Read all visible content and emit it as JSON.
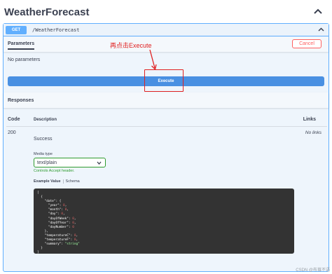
{
  "section_title": "WeatherForecast",
  "operation": {
    "method": "GET",
    "path": "/WeatherForecast"
  },
  "parameters": {
    "tab_label": "Parameters",
    "cancel_label": "Cancel",
    "empty_text": "No parameters"
  },
  "execute": {
    "label": "Execute",
    "annotation": "再点击Execute"
  },
  "responses": {
    "header": "Responses",
    "columns": {
      "code": "Code",
      "description": "Description",
      "links": "Links"
    },
    "row": {
      "code": "200",
      "description": "Success",
      "links": "No links"
    },
    "media_type_label": "Media type",
    "media_type_value": "text/plain",
    "controls_accept": "Controls Accept header.",
    "tabs": {
      "example_value": "Example Value",
      "schema": "Schema"
    },
    "example": [
      "[",
      "  {",
      "    \"date\": {",
      "      \"year\": 0,",
      "      \"month\": 0,",
      "      \"day\": 0,",
      "      \"dayOfWeek\": 0,",
      "      \"dayOfYear\": 0,",
      "      \"dayNumber\": 0",
      "    },",
      "    \"temperatureC\": 0,",
      "    \"temperatureF\": 0,",
      "    \"summary\": \"string\"",
      "  }",
      "]"
    ]
  },
  "watermark": "CSDN @布莨不语",
  "colors": {
    "get": "#61affe",
    "execute": "#4990e2",
    "cancel": "#ff6060",
    "annotation": "#e02020",
    "highlight": "#2e9b2e"
  },
  "icons": {
    "collapse": "chevron-up-icon",
    "select": "chevron-down-icon"
  }
}
